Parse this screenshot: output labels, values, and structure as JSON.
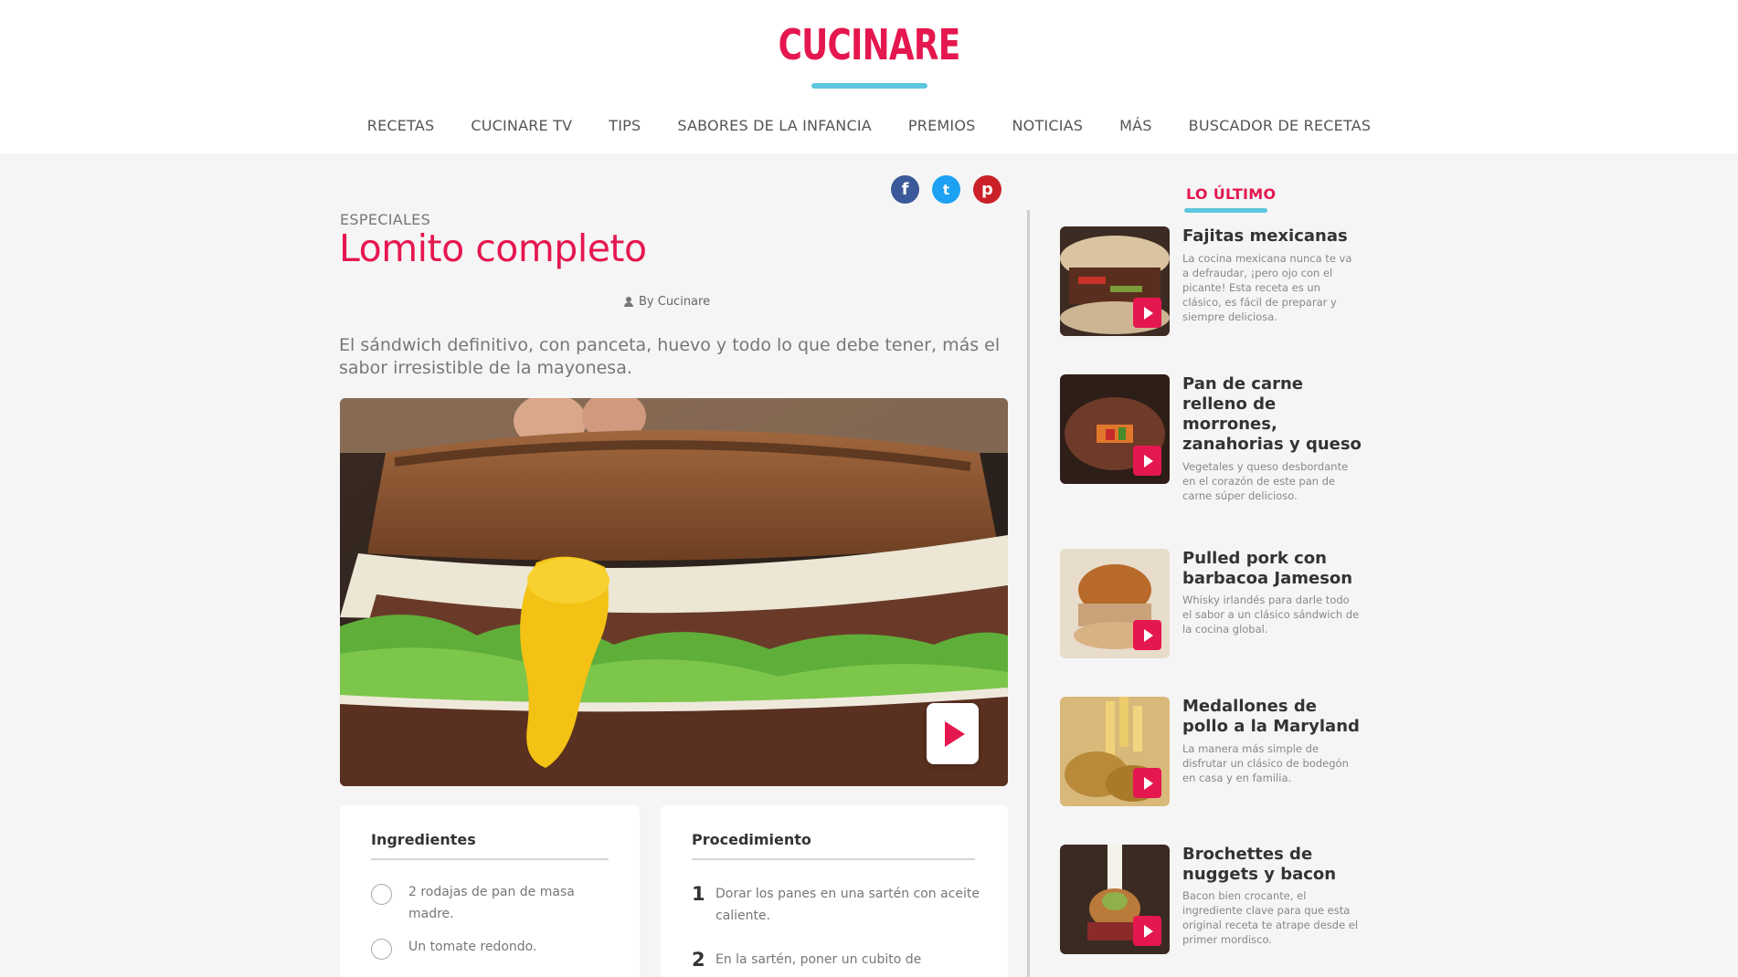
{
  "brand": {
    "name": "CUCINARE",
    "accent": "#e5174f",
    "underline": "#5ec6df"
  },
  "nav": [
    "RECETAS",
    "CUCINARE TV",
    "TIPS",
    "SABORES DE LA INFANCIA",
    "PREMIOS",
    "NOTICIAS",
    "MÁS",
    "BUSCADOR DE RECETAS"
  ],
  "share": {
    "facebook": "f",
    "twitter": "t",
    "pinterest": "p"
  },
  "article": {
    "category": "ESPECIALES",
    "title": "Lomito completo",
    "author": "By Cucinare",
    "summary": "El sándwich definitivo, con panceta, huevo y todo lo que debe tener, más el sabor irresistible de la mayonesa."
  },
  "ingredients": {
    "heading": "Ingredientes",
    "items": [
      "2 rodajas de pan de masa madre.",
      "Un tomate redondo."
    ]
  },
  "procedure": {
    "heading": "Procedimiento",
    "steps": [
      {
        "num": "1",
        "text": "Dorar los panes en una sartén con aceite caliente."
      },
      {
        "num": "2",
        "text": "En la sartén, poner un cubito de"
      }
    ]
  },
  "sidebar": {
    "heading": "LO ÚLTIMO",
    "items": [
      {
        "title": "Fajitas mexicanas",
        "desc": "La cocina mexicana nunca te va a defraudar, ¡pero ojo con el picante! Esta receta es un clásico, es fácil de preparar y siempre deliciosa."
      },
      {
        "title": "Pan de carne relleno de morrones, zanahorias y queso",
        "desc": "Vegetales y queso desbordante en el corazón de este pan de carne súper delicioso."
      },
      {
        "title": "Pulled pork con barbacoa Jameson",
        "desc": "Whisky irlandés para darle todo el sabor a un clásico sándwich de la cocina global."
      },
      {
        "title": "Medallones de pollo a la Maryland",
        "desc": "La manera más simple de disfrutar un clásico de bodegón en casa y en familia."
      },
      {
        "title": "Brochettes de nuggets y bacon",
        "desc": "Bacon bien crocante, el ingrediente clave para que esta original receta te atrape desde el primer mordisco."
      }
    ]
  }
}
